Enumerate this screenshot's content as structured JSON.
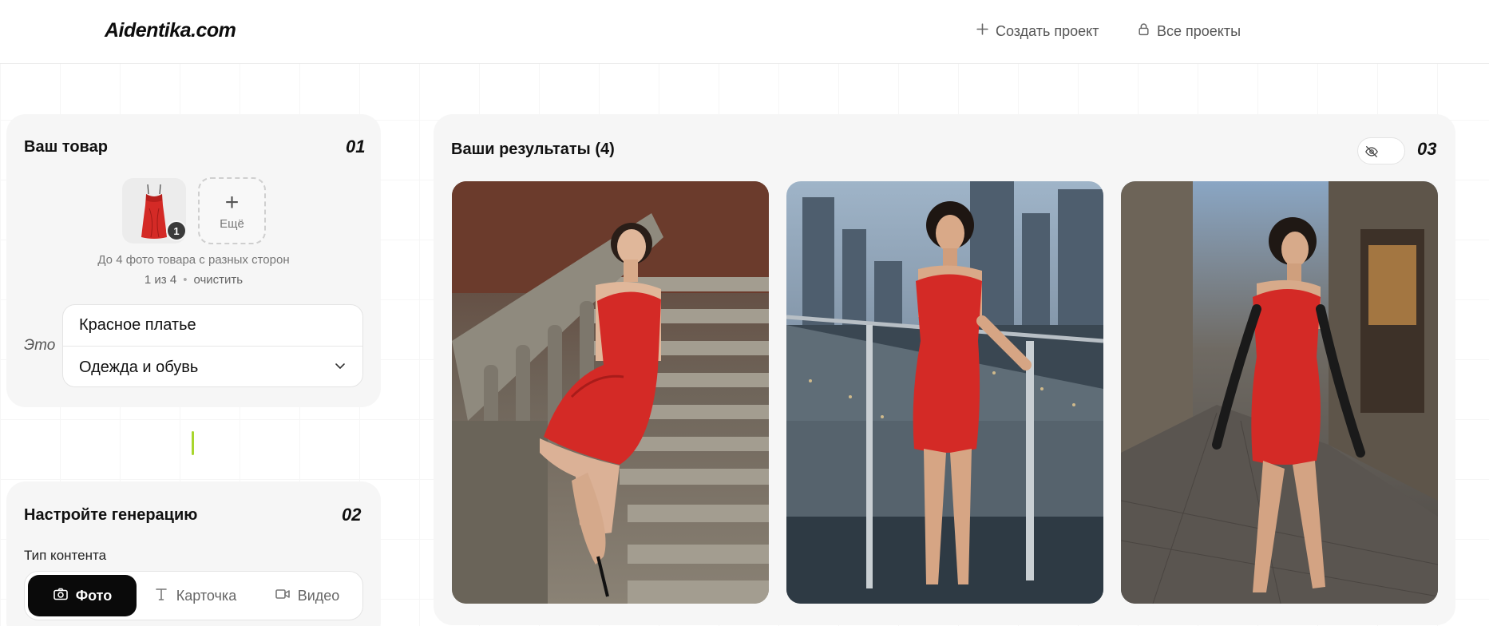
{
  "header": {
    "logo": "Aidentika.com",
    "create_project": "Создать проект",
    "all_projects": "Все проекты"
  },
  "product": {
    "title": "Ваш товар",
    "step": "01",
    "photo_count_badge": "1",
    "add_more_label": "Ещё",
    "hint": "До 4 фото товара с разных сторон",
    "counter": "1 из 4",
    "clear_label": "очистить",
    "this_label": "Это",
    "name_value": "Красное платье",
    "category_value": "Одежда и обувь"
  },
  "settings": {
    "title": "Настройте генерацию",
    "step": "02",
    "content_type_label": "Тип контента",
    "options": [
      "Фото",
      "Карточка",
      "Видео"
    ],
    "selected": "Фото"
  },
  "results": {
    "title": "Ваши результаты (4)",
    "step": "03"
  },
  "colors": {
    "accent": "#a8d62d",
    "dress_red": "#d42a26",
    "active_segment": "#0a0a0a"
  },
  "icons": {
    "create": "plus-icon",
    "all_projects": "lock-icon",
    "visibility": "eye-off-icon",
    "photo": "camera-icon",
    "card": "text-icon",
    "video": "video-icon",
    "select": "chevron-down-icon"
  }
}
